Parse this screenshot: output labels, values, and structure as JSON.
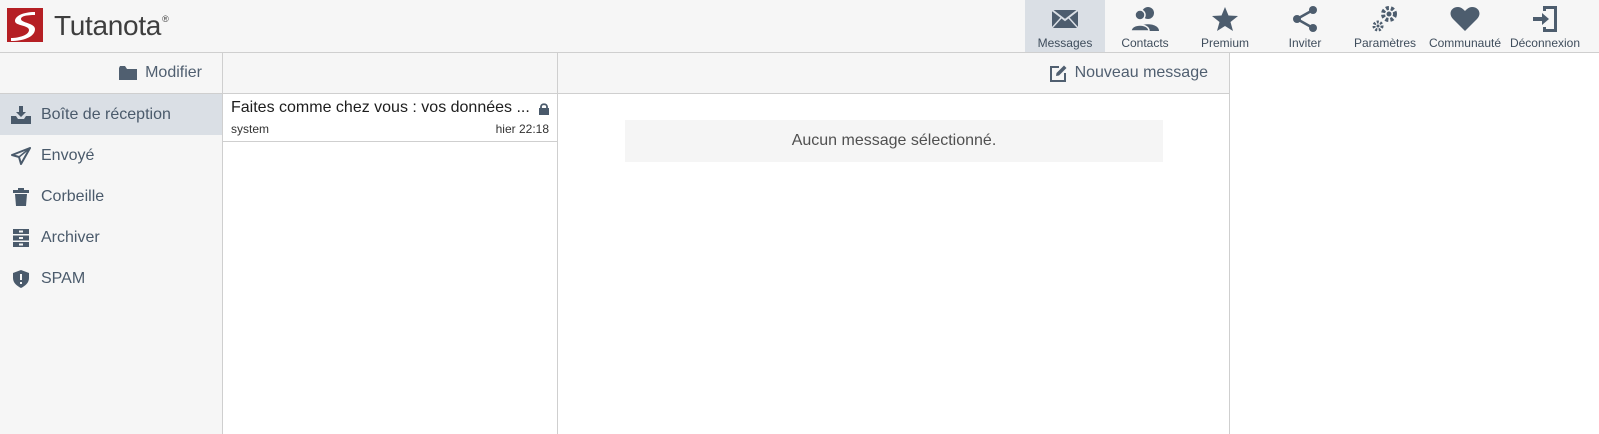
{
  "app": {
    "brand_main": "Tutanota",
    "brand_mark": "®",
    "brand_color": "#b51f24"
  },
  "nav": [
    {
      "label": "Messages",
      "icon": "envelope-icon",
      "active": true
    },
    {
      "label": "Contacts",
      "icon": "contacts-icon",
      "active": false
    },
    {
      "label": "Premium",
      "icon": "star-icon",
      "active": false
    },
    {
      "label": "Inviter",
      "icon": "share-icon",
      "active": false
    },
    {
      "label": "Paramètres",
      "icon": "gear-icon",
      "active": false
    },
    {
      "label": "Communauté",
      "icon": "heart-icon",
      "active": false
    },
    {
      "label": "Déconnexion",
      "icon": "logout-icon",
      "active": false
    }
  ],
  "sidebar": {
    "edit_label": "Modifier",
    "folders": [
      {
        "label": "Boîte de réception",
        "icon": "inbox-icon",
        "active": true
      },
      {
        "label": "Envoyé",
        "icon": "paper-plane-icon",
        "active": false
      },
      {
        "label": "Corbeille",
        "icon": "trash-icon",
        "active": false
      },
      {
        "label": "Archiver",
        "icon": "archive-icon",
        "active": false
      },
      {
        "label": "SPAM",
        "icon": "shield-icon",
        "active": false
      }
    ]
  },
  "maillist": {
    "items": [
      {
        "subject": "Faites comme chez vous : vos données ...",
        "sender": "system",
        "time": "hier 22:18",
        "encrypted": true
      }
    ]
  },
  "viewer": {
    "new_message_label": "Nouveau message",
    "empty_text": "Aucun message sélectionné."
  },
  "colors": {
    "header_bg": "#f6f6f6",
    "active_bg": "#dadfe5",
    "icon_color": "#4d5d6e"
  }
}
